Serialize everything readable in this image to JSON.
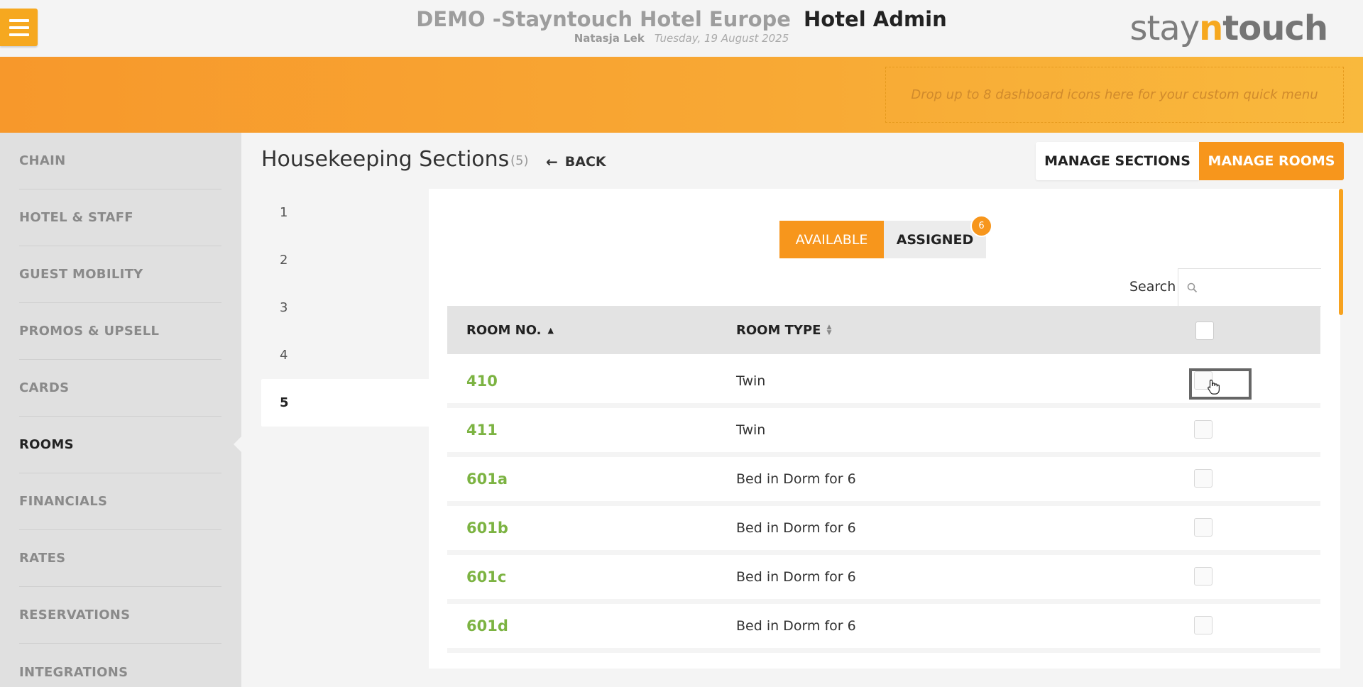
{
  "header": {
    "hotel_name": "DEMO -Stayntouch Hotel Europe",
    "app_name": "Hotel Admin",
    "user": "Natasja Lek",
    "date": "Tuesday, 19 August 2025",
    "logo": {
      "part1": "stay",
      "part2": "n",
      "part3": "touch"
    }
  },
  "quick_menu": {
    "placeholder": "Drop up to 8 dashboard icons here for your custom quick menu"
  },
  "sidebar": {
    "items": [
      {
        "label": "CHAIN",
        "active": false
      },
      {
        "label": "HOTEL & STAFF",
        "active": false
      },
      {
        "label": "GUEST MOBILITY",
        "active": false
      },
      {
        "label": "PROMOS & UPSELL",
        "active": false
      },
      {
        "label": "CARDS",
        "active": false
      },
      {
        "label": "ROOMS",
        "active": true
      },
      {
        "label": "FINANCIALS",
        "active": false
      },
      {
        "label": "RATES",
        "active": false
      },
      {
        "label": "RESERVATIONS",
        "active": false
      },
      {
        "label": "INTEGRATIONS",
        "active": false
      }
    ]
  },
  "page": {
    "title": "Housekeeping Sections",
    "count": "(5)",
    "back_label": "BACK",
    "manage_sections_label": "MANAGE SECTIONS",
    "manage_rooms_label": "MANAGE ROOMS"
  },
  "sections": [
    "1",
    "2",
    "3",
    "4",
    "5"
  ],
  "active_section": "5",
  "toggle": {
    "available_label": "AVAILABLE",
    "assigned_label": "ASSIGNED",
    "assigned_count": "6",
    "active": "AVAILABLE"
  },
  "search": {
    "label": "Search",
    "value": ""
  },
  "table": {
    "columns": [
      "ROOM NO.",
      "ROOM TYPE"
    ],
    "sort_column": "ROOM NO.",
    "sort_direction": "ascending",
    "rows": [
      {
        "room": "410",
        "type": "Twin",
        "checked": false
      },
      {
        "room": "411",
        "type": "Twin",
        "checked": false
      },
      {
        "room": "601a",
        "type": "Bed in Dorm for 6",
        "checked": false
      },
      {
        "room": "601b",
        "type": "Bed in Dorm for 6",
        "checked": false
      },
      {
        "room": "601c",
        "type": "Bed in Dorm for 6",
        "checked": false
      },
      {
        "room": "601d",
        "type": "Bed in Dorm for 6",
        "checked": false
      }
    ]
  },
  "colors": {
    "accent": "#f7961c",
    "room_link": "#7cb342",
    "sidebar_bg": "#e0e0e0"
  }
}
